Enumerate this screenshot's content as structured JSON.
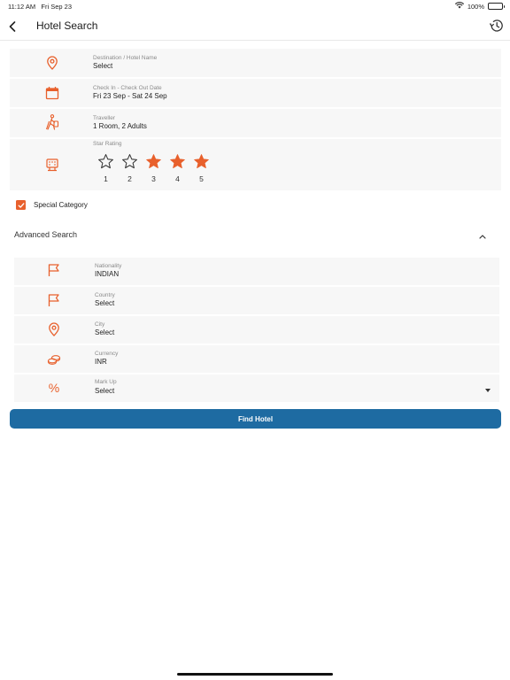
{
  "status_bar": {
    "time": "11:12 AM",
    "date": "Fri Sep 23",
    "battery_text": "100%",
    "battery_level_percent": 100
  },
  "header": {
    "title": "Hotel Search"
  },
  "search": {
    "destination": {
      "label": "Destination / Hotel Name",
      "value": "Select"
    },
    "dates": {
      "label": "Check In - Check Out Date",
      "value": "Fri 23 Sep - Sat 24 Sep"
    },
    "traveller": {
      "label": "Traveller",
      "value": "1 Room, 2 Adults"
    },
    "star_rating": {
      "label": "Star Rating",
      "stars": [
        {
          "num": "1",
          "selected": false
        },
        {
          "num": "2",
          "selected": false
        },
        {
          "num": "3",
          "selected": true
        },
        {
          "num": "4",
          "selected": true
        },
        {
          "num": "5",
          "selected": true
        }
      ]
    }
  },
  "special_category": {
    "label": "Special Category",
    "checked": true
  },
  "advanced": {
    "title": "Advanced Search",
    "expanded": true,
    "nationality": {
      "label": "Nationality",
      "value": "INDIAN"
    },
    "country": {
      "label": "Country",
      "value": "Select"
    },
    "city": {
      "label": "City",
      "value": "Select"
    },
    "currency": {
      "label": "Currency",
      "value": "INR"
    },
    "markup": {
      "label": "Mark Up",
      "value": "Select",
      "icon_glyph": "%"
    }
  },
  "actions": {
    "find_hotel": "Find Hotel"
  },
  "colors": {
    "accent": "#e8602c",
    "primary": "#1e6ba2",
    "row_bg": "#f7f7f7"
  }
}
